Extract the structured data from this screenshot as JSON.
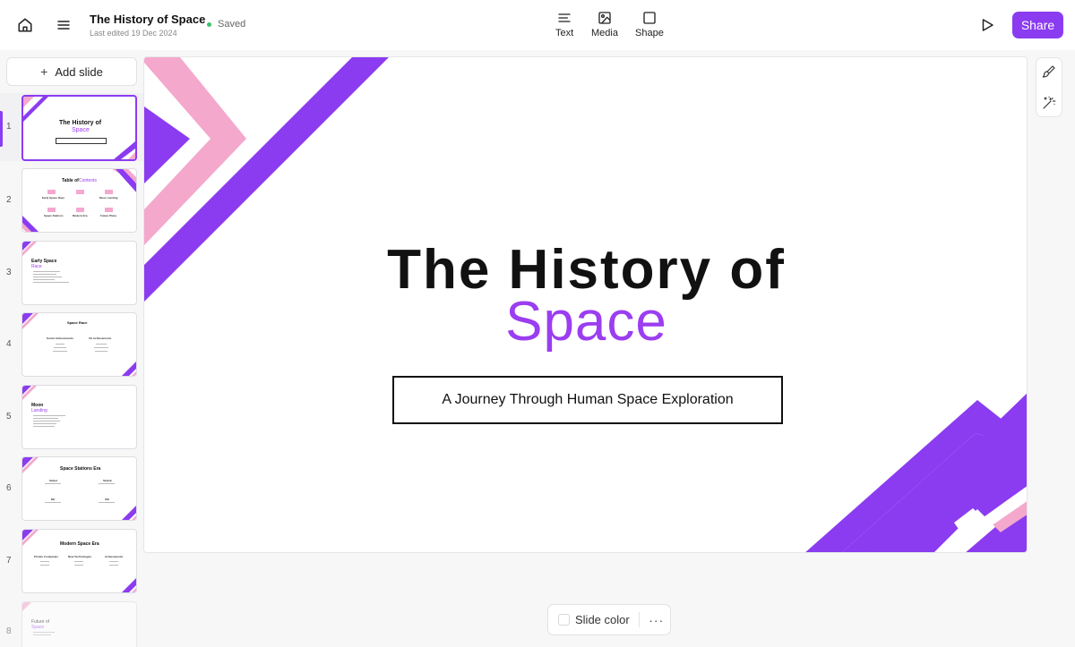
{
  "header": {
    "doc_title": "The History of Space",
    "last_edited": "Last edited 19 Dec 2024",
    "save_status": "Saved",
    "tools": [
      {
        "label": "Text",
        "icon": "text-align-icon"
      },
      {
        "label": "Media",
        "icon": "image-icon"
      },
      {
        "label": "Shape",
        "icon": "square-icon"
      }
    ],
    "share_label": "Share"
  },
  "sidebar": {
    "add_slide_label": "Add slide",
    "slides": [
      {
        "num": "1",
        "title": "The History of",
        "accent": "Space",
        "sub": "A Journey Through Human Space Exploration"
      },
      {
        "num": "2",
        "title": "Table of",
        "accent": "Contents",
        "items": [
          "Early Space Race",
          "Moon Landing",
          "Space Stations",
          "Modern Era",
          "Future Plans"
        ]
      },
      {
        "num": "3",
        "title": "Early Space",
        "accent": "Race"
      },
      {
        "num": "4",
        "title": "Space Race",
        "items": [
          "Soviet Achievements",
          "US Achievements"
        ]
      },
      {
        "num": "5",
        "title": "Moon",
        "accent": "Landing"
      },
      {
        "num": "6",
        "title": "Space Stations Era",
        "items": [
          "Salyut",
          "Skylab",
          "Mir",
          "ISS"
        ]
      },
      {
        "num": "7",
        "title": "Modern Space Era",
        "items": [
          "Private Companies",
          "New Technologies",
          "Achievements"
        ]
      },
      {
        "num": "8",
        "title": "Future of",
        "accent": "Space"
      }
    ]
  },
  "slide": {
    "title_line1": "The History of",
    "title_line2": "Space",
    "subtitle": "A Journey Through Human Space Exploration"
  },
  "bottom_bar": {
    "slide_color_label": "Slide color",
    "more_label": "···"
  },
  "colors": {
    "accent_purple": "#8b3cf0",
    "accent_pink": "#f4a8cc"
  }
}
